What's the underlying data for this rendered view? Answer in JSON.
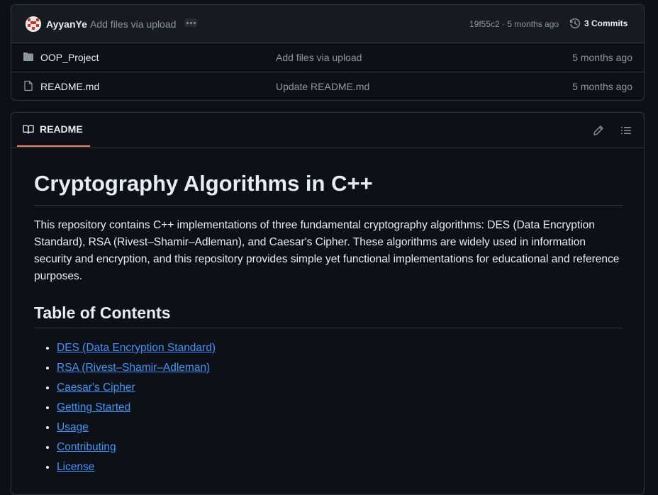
{
  "commit": {
    "author": "AyyanYe",
    "message": "Add files via upload",
    "sha_time": "19f55c2 · 5 months ago",
    "commits_label": "3 Commits"
  },
  "files": [
    {
      "name": "OOP_Project",
      "type": "folder",
      "message": "Add files via upload",
      "date": "5 months ago"
    },
    {
      "name": "README.md",
      "type": "file",
      "message": "Update README.md",
      "date": "5 months ago"
    }
  ],
  "readme": {
    "tab_label": "README",
    "title": "Cryptography Algorithms in C++",
    "intro": "This repository contains C++ implementations of three fundamental cryptography algorithms: DES (Data Encryption Standard), RSA (Rivest–Shamir–Adleman), and Caesar's Cipher. These algorithms are widely used in information security and encryption, and this repository provides simple yet functional implementations for educational and reference purposes.",
    "toc_heading": "Table of Contents",
    "toc": [
      "DES (Data Encryption Standard)",
      "RSA (Rivest–Shamir–Adleman)",
      "Caesar's Cipher",
      "Getting Started",
      "Usage",
      "Contributing",
      "License"
    ]
  },
  "colors": {
    "background": "#0d1117",
    "border": "#30363d",
    "muted_text": "#8d96a0",
    "link": "#4493f8",
    "tab_underline": "#f78166"
  },
  "icons": [
    "avatar",
    "ellipsis-icon",
    "history-icon",
    "folder-icon",
    "file-icon",
    "book-icon",
    "pencil-icon",
    "list-icon"
  ]
}
